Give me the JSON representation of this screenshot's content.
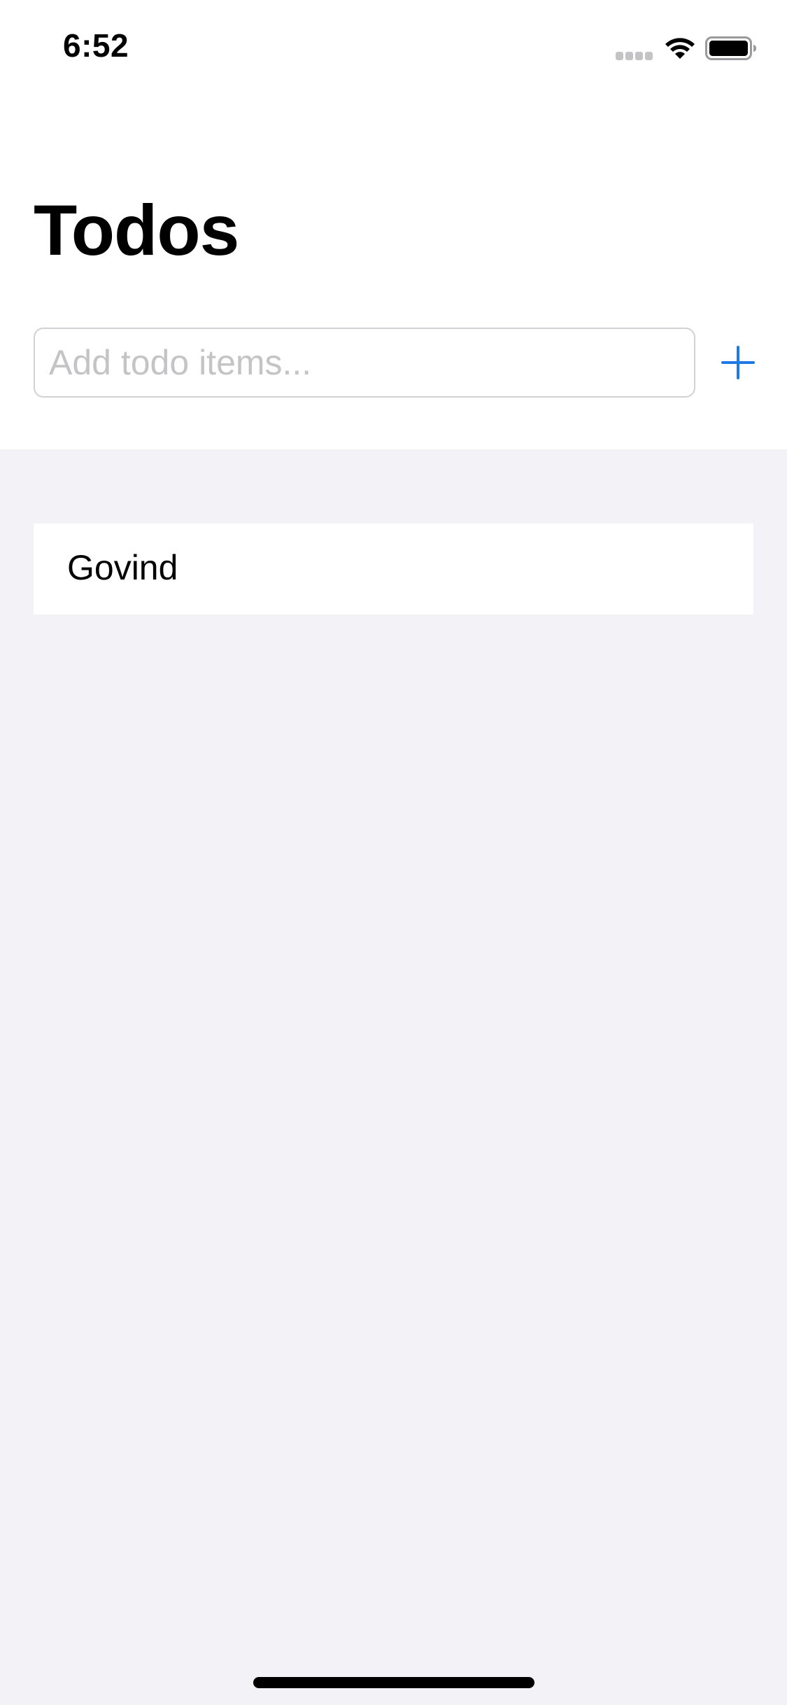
{
  "status_bar": {
    "time": "6:52",
    "icons": [
      "signal-dots-icon",
      "wifi-icon",
      "battery-icon"
    ]
  },
  "header": {
    "title": "Todos"
  },
  "add_todo": {
    "value": "",
    "placeholder": "Add todo items...",
    "add_icon": "plus-icon"
  },
  "todos": [
    {
      "label": "Govind"
    }
  ],
  "colors": {
    "accent": "#1f7ae8",
    "background": "#f2f2f7",
    "surface": "#ffffff",
    "placeholder": "#c4c4c6",
    "input_border": "#d1d1d6"
  }
}
